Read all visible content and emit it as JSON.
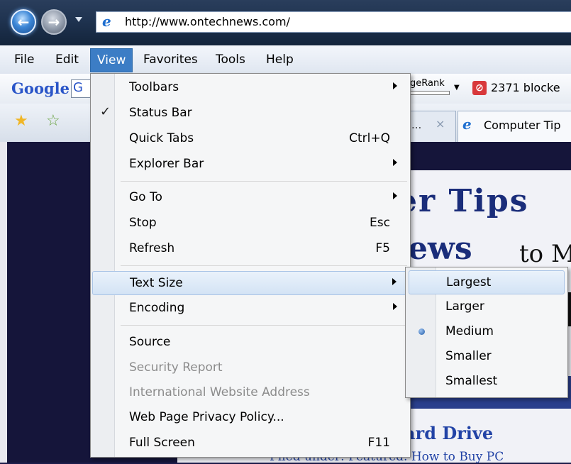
{
  "address_bar": {
    "url": "http://www.ontechnews.com/"
  },
  "menubar": {
    "items": [
      "File",
      "Edit",
      "View",
      "Favorites",
      "Tools",
      "Help"
    ],
    "active": "View"
  },
  "google_toolbar": {
    "logo": "Google",
    "search_partial": "G",
    "pagerank_label": "geRank",
    "blocked_count_text": "2371 blocke"
  },
  "tabs": [
    {
      "title": "...",
      "close": "×"
    },
    {
      "title": "Computer Tip"
    }
  ],
  "page": {
    "banner_top": "er Tips",
    "banner_mid": "ews",
    "banner_to": "to M",
    "headline": "ard Drive",
    "subline": "Filed under: Featured. How to Buy PC"
  },
  "view_menu": {
    "items": [
      {
        "label": "Toolbars",
        "shortcut": "",
        "submenu": true,
        "checked": false,
        "disabled": false
      },
      {
        "label": "Status Bar",
        "shortcut": "",
        "submenu": false,
        "checked": true,
        "disabled": false
      },
      {
        "label": "Quick Tabs",
        "shortcut": "Ctrl+Q",
        "submenu": false,
        "checked": false,
        "disabled": false
      },
      {
        "label": "Explorer Bar",
        "shortcut": "",
        "submenu": true,
        "checked": false,
        "disabled": false
      },
      {
        "label": "Go To",
        "shortcut": "",
        "submenu": true,
        "checked": false,
        "disabled": false
      },
      {
        "label": "Stop",
        "shortcut": "Esc",
        "submenu": false,
        "checked": false,
        "disabled": false
      },
      {
        "label": "Refresh",
        "shortcut": "F5",
        "submenu": false,
        "checked": false,
        "disabled": false
      },
      {
        "label": "Text Size",
        "shortcut": "",
        "submenu": true,
        "checked": false,
        "disabled": false,
        "highlighted": true
      },
      {
        "label": "Encoding",
        "shortcut": "",
        "submenu": true,
        "checked": false,
        "disabled": false
      },
      {
        "label": "Source",
        "shortcut": "",
        "submenu": false,
        "checked": false,
        "disabled": false
      },
      {
        "label": "Security Report",
        "shortcut": "",
        "submenu": false,
        "checked": false,
        "disabled": true
      },
      {
        "label": "International Website Address",
        "shortcut": "",
        "submenu": false,
        "checked": false,
        "disabled": true
      },
      {
        "label": "Web Page Privacy Policy...",
        "shortcut": "",
        "submenu": false,
        "checked": false,
        "disabled": false
      },
      {
        "label": "Full Screen",
        "shortcut": "F11",
        "submenu": false,
        "checked": false,
        "disabled": false
      }
    ]
  },
  "text_size_menu": {
    "items": [
      {
        "label": "Largest",
        "selected": false,
        "highlighted": true
      },
      {
        "label": "Larger",
        "selected": false
      },
      {
        "label": "Medium",
        "selected": true
      },
      {
        "label": "Smaller",
        "selected": false
      },
      {
        "label": "Smallest",
        "selected": false
      }
    ]
  },
  "icons": {
    "back": "back-arrow-icon",
    "forward": "forward-arrow-icon",
    "favorites": "favorites-star-icon",
    "add_favorite": "add-favorite-icon",
    "ie": "internet-explorer-icon",
    "popup_blocker": "popup-blocker-icon"
  }
}
